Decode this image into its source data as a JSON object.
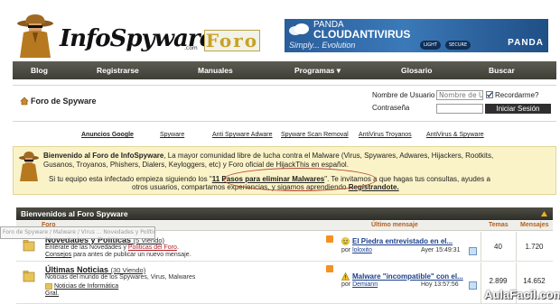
{
  "header": {
    "logo_text": "InfoSpyware",
    "logo_com": ".com",
    "logo_badge": "Foro",
    "banner": {
      "line1": "PANDA",
      "line2": "CLOUDANTIVIRUS",
      "tagline": "Simply... Evolution",
      "pill1": "LIGHT",
      "pill2": "SECURE",
      "brand": "PANDA"
    }
  },
  "nav": {
    "items": [
      "Blog",
      "Registrarse",
      "Manuales",
      "Programas",
      "Glosario",
      "Buscar"
    ]
  },
  "login": {
    "panel_title": "Foro de Spyware",
    "username_label": "Nombre de Usuario",
    "username_value": "Nombre de U",
    "password_label": "Contraseña",
    "remember_label": "Recordarme?",
    "remember_checked": true,
    "button_label": "Iniciar Sesión"
  },
  "links": [
    "Anuncios Google",
    "Spyware",
    "Anti Spyware Adware",
    "Spyware Scan Removal",
    "AntiVirus Troyanos",
    "AntiVirus & Spyware"
  ],
  "welcome": {
    "line1_bold": "Bienvenido al Foro de InfoSpyware",
    "line1_rest": ", La mayor comunidad libre de lucha contra el Malware (Virus, Spywares, Adwares, Hijackers, Rootkits,",
    "line2": "Gusanos, Troyanos, Phishers, Dialers, Keyloggers, etc) y Foro oficial de HijackThis en español.",
    "line3_pre": "Si tu equipo esta infectado empieza siguiendo los \"",
    "line3_link": "11 Pasos para eliminar Malwares",
    "line3_post": "\". Te invitamos a que hagas tus consultas, ayudes a",
    "line4_pre": "otros usuarios,  compartamos experiencias, y sigamos aprendiendo ",
    "line4_link": "Regístrandote."
  },
  "forum_table": {
    "title": "Bienvenidos al Foro Spyware",
    "col_forum": "Foro",
    "col_last": "Último mensaje",
    "col_topics": "Temas",
    "col_posts": "Mensajes",
    "tooltip": "Foro de Spyware / Malware / Virus ... Novedades y Políticas",
    "rows": [
      {
        "title": "Novedades y Políticas",
        "viewing": "(5 Viendo)",
        "desc1_a": "Entérate de las Novedades y ",
        "desc1_b": "Políticas del Foro",
        "desc1_c": ".",
        "desc2_a": "Consejos",
        "desc2_b": " para antes de publicar un nuevo mensaje.",
        "last_title": "El Piedra entrevistado en el...",
        "last_by_label": "por",
        "last_by": "loloxito",
        "last_time": "Ayer 15:49:31",
        "topics": "40",
        "posts": "1.720"
      },
      {
        "title": "Últimas Noticias",
        "viewing": "(30 Viendo)",
        "desc1_a": "Noticias del mundo de los Spywares, Virus, Malwares",
        "desc2_a": "Noticias de Informática",
        "desc3_a": "Gral.",
        "last_title": "Malware \"incompatible\" con el...",
        "last_by_label": "por",
        "last_by": "Demiann",
        "last_time": "Hoy 13:57:56",
        "topics": "2.899",
        "posts": "14.652"
      }
    ]
  },
  "watermark": "AulaFacil.com"
}
